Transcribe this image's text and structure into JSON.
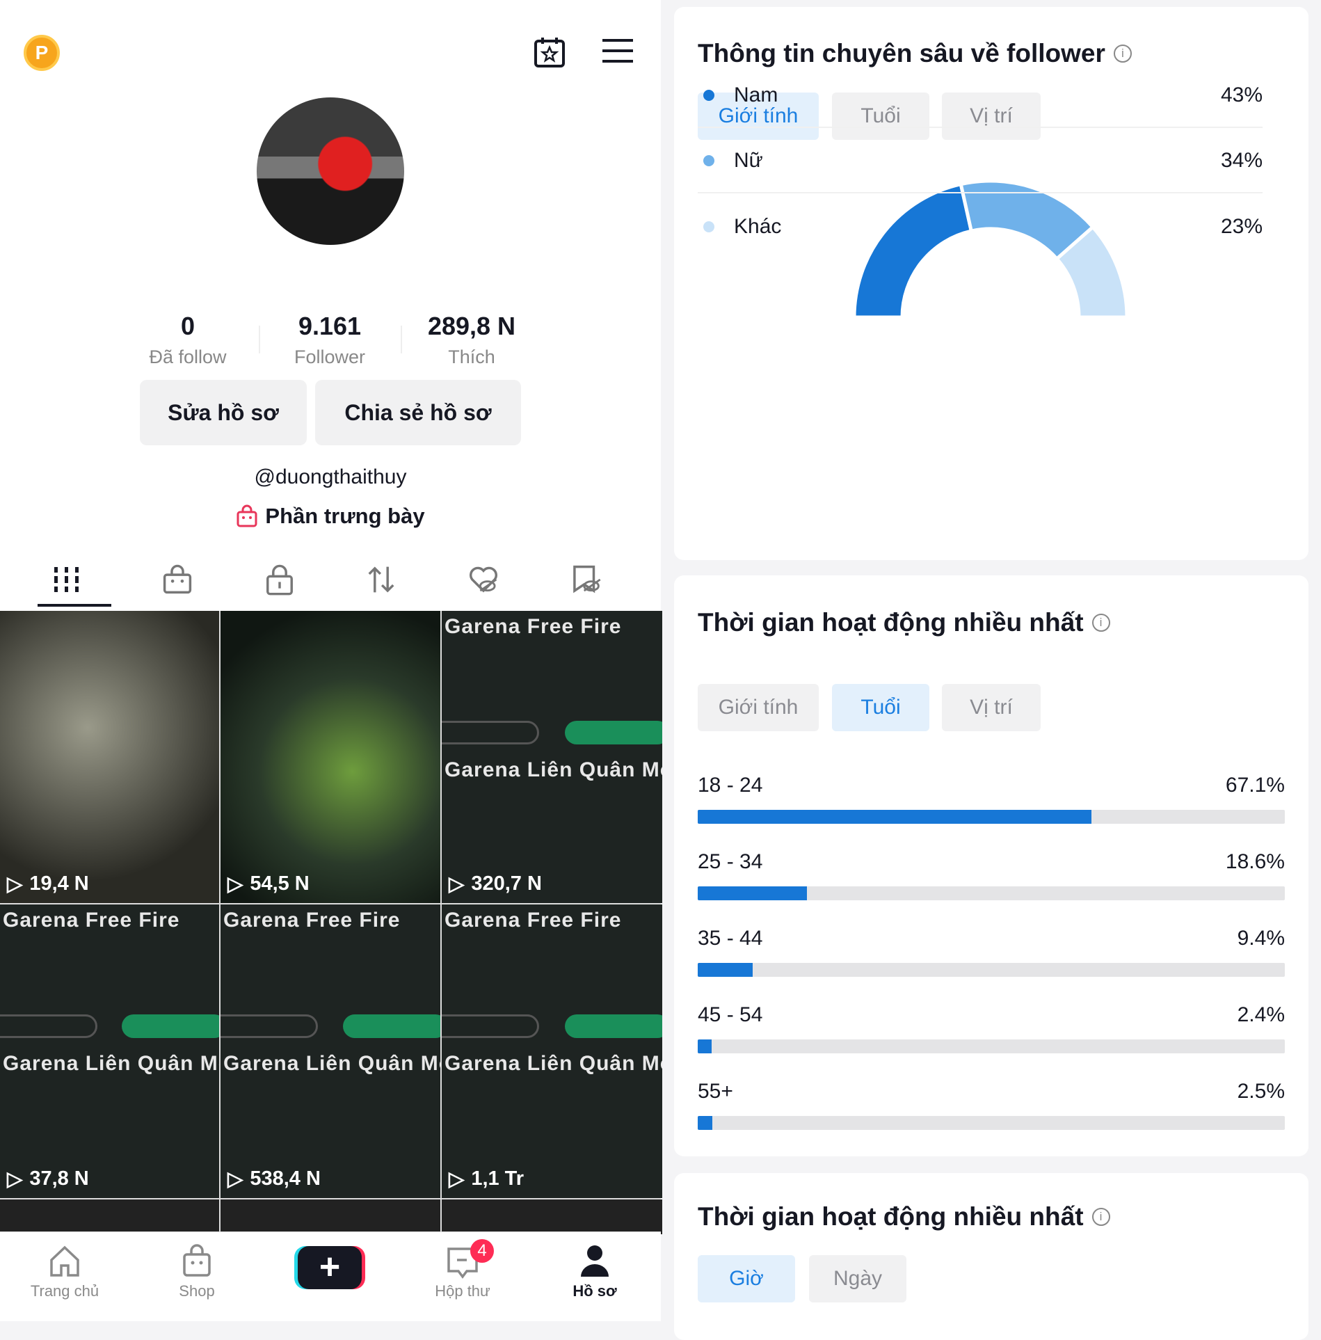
{
  "profile": {
    "stats": [
      {
        "value": "0",
        "label": "Đã follow"
      },
      {
        "value": "9.161",
        "label": "Follower"
      },
      {
        "value": "289,8 N",
        "label": "Thích"
      }
    ],
    "edit_label": "Sửa hồ sơ",
    "share_label": "Chia sẻ hồ sơ",
    "handle": "@duongthaithuy",
    "showcase": "Phần trưng bày"
  },
  "content_tabs": [
    "grid-icon",
    "shop-bag-icon",
    "lock-icon",
    "repost-icon",
    "liked-hidden-icon",
    "saved-hidden-icon"
  ],
  "videos": [
    {
      "views": "19,4 N",
      "caption": "",
      "caption2": ""
    },
    {
      "views": "54,5 N",
      "caption": "",
      "caption2": ""
    },
    {
      "views": "320,7 N",
      "caption": "Garena Free Fire",
      "caption2": "Garena Liên Quân Mobile"
    },
    {
      "views": "37,8 N",
      "caption": "Garena Free Fire",
      "caption2": "Garena Liên Quân Mobile"
    },
    {
      "views": "538,4 N",
      "caption": "Garena Free Fire",
      "caption2": "Garena Liên Quân Mobile"
    },
    {
      "views": "1,1 Tr",
      "caption": "Garena Free Fire",
      "caption2": "Garena Liên Quân Mobile"
    }
  ],
  "bottom_nav": {
    "home": "Trang chủ",
    "shop": "Shop",
    "inbox": "Hộp thư",
    "inbox_badge": "4",
    "profile": "Hồ sơ"
  },
  "follower_insights": {
    "title": "Thông tin chuyên sâu về follower",
    "tabs": [
      "Giới tính",
      "Tuổi",
      "Vị trí"
    ],
    "active_tab": 0,
    "gender": [
      {
        "label": "Nam",
        "value": 43,
        "pct": "43%",
        "color": "#1777d6"
      },
      {
        "label": "Nữ",
        "value": 34,
        "pct": "34%",
        "color": "#6fb1ea"
      },
      {
        "label": "Khác",
        "value": 23,
        "pct": "23%",
        "color": "#c9e2f8"
      }
    ]
  },
  "activity_age": {
    "title": "Thời gian hoạt động nhiều nhất",
    "tabs": [
      "Giới tính",
      "Tuổi",
      "Vị trí"
    ],
    "active_tab": 1,
    "ages": [
      {
        "label": "18 - 24",
        "value": 67.1,
        "pct": "67.1%"
      },
      {
        "label": "25 - 34",
        "value": 18.6,
        "pct": "18.6%"
      },
      {
        "label": "35 - 44",
        "value": 9.4,
        "pct": "9.4%"
      },
      {
        "label": "45 - 54",
        "value": 2.4,
        "pct": "2.4%"
      },
      {
        "label": "55+",
        "value": 2.5,
        "pct": "2.5%"
      }
    ]
  },
  "activity_time": {
    "title": "Thời gian hoạt động nhiều nhất",
    "tabs": [
      "Giờ",
      "Ngày"
    ],
    "active_tab": 0
  }
}
